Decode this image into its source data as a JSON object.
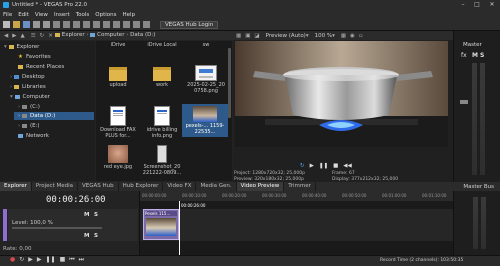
{
  "window": {
    "title": "Untitled * - VEGAS Pro 22.0"
  },
  "menu": [
    "File",
    "Edit",
    "View",
    "Insert",
    "Tools",
    "Options",
    "Help"
  ],
  "toolbar": {
    "hub_login": "VEGAS Hub Login"
  },
  "explorer": {
    "breadcrumbs": [
      "Explorer",
      "Computer",
      "Data (D:)"
    ],
    "tree": [
      {
        "label": "Explorer",
        "icon": "folder-icon"
      },
      {
        "label": "Favorites",
        "icon": "star-icon"
      },
      {
        "label": "Recent Places",
        "icon": "folder-icon"
      },
      {
        "label": "Desktop",
        "icon": "folder-icon"
      },
      {
        "label": "Libraries",
        "icon": "folder-icon"
      },
      {
        "label": "Computer",
        "icon": "computer-icon"
      },
      {
        "label": "(C:)",
        "icon": "drive-icon"
      },
      {
        "label": "Data (D:)",
        "icon": "drive-icon"
      },
      {
        "label": "(E:)",
        "icon": "drive-icon"
      },
      {
        "label": "Network",
        "icon": "network-icon"
      }
    ],
    "files": [
      {
        "name": "iDrive",
        "kind": "label"
      },
      {
        "name": "iDrive Local",
        "kind": "label"
      },
      {
        "name": "sw",
        "kind": "label"
      },
      {
        "name": "upload",
        "kind": "folder"
      },
      {
        "name": "work",
        "kind": "folder"
      },
      {
        "name": "2025-02-25_20 0758.png",
        "kind": "image"
      },
      {
        "name": "Download FAX PLUS for...",
        "kind": "doc"
      },
      {
        "name": "idrive billing info.png",
        "kind": "doc"
      },
      {
        "name": "pexels-... 1159-22535...",
        "kind": "video"
      },
      {
        "name": "red eye.jpg",
        "kind": "face"
      },
      {
        "name": "Screenshot_20 221222-0809...",
        "kind": "screenshot"
      }
    ]
  },
  "preview": {
    "mode": "Preview (Auto)",
    "zoom": "100 %",
    "info": {
      "project": "Project: 1280x720x32; 25,000p",
      "preview": "Preview: 320x180x32; 25,000p",
      "display": "Display: 377x212x32; 25,000",
      "frame_label": "Frame:",
      "frame": "67"
    }
  },
  "master": {
    "label": "Master",
    "bus_label": "Master Bus"
  },
  "dock_tabs": [
    "Explorer",
    "Project Media",
    "VEGAS Hub",
    "Hub Explorer",
    "Video FX",
    "Media Gen.",
    "Video Preview",
    "Trimmer"
  ],
  "timeline": {
    "timecode": "00:00:26:00",
    "cursor_timecode": "00:00:26:00",
    "ruler": [
      "00:00:00:00",
      "00:00:10:00",
      "00:00:20:00",
      "00:00:30:00",
      "00:00:40:00",
      "00:00:50:00",
      "00:01:00:00",
      "00:01:10:00"
    ],
    "track_level": "Level: 100,0 %",
    "rate": "Rate: 0,00",
    "clip_label": "Pexels 115...",
    "status": "Record Time (2 channels): 103:50:35"
  }
}
